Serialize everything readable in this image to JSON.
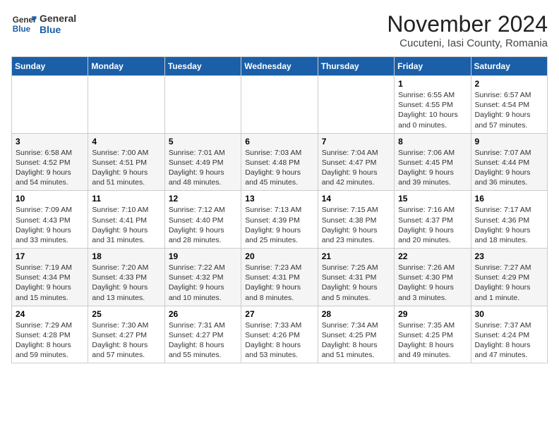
{
  "logo": {
    "line1": "General",
    "line2": "Blue"
  },
  "title": "November 2024",
  "location": "Cucuteni, Iasi County, Romania",
  "headers": [
    "Sunday",
    "Monday",
    "Tuesday",
    "Wednesday",
    "Thursday",
    "Friday",
    "Saturday"
  ],
  "weeks": [
    [
      {
        "day": "",
        "info": ""
      },
      {
        "day": "",
        "info": ""
      },
      {
        "day": "",
        "info": ""
      },
      {
        "day": "",
        "info": ""
      },
      {
        "day": "",
        "info": ""
      },
      {
        "day": "1",
        "info": "Sunrise: 6:55 AM\nSunset: 4:55 PM\nDaylight: 10 hours\nand 0 minutes."
      },
      {
        "day": "2",
        "info": "Sunrise: 6:57 AM\nSunset: 4:54 PM\nDaylight: 9 hours\nand 57 minutes."
      }
    ],
    [
      {
        "day": "3",
        "info": "Sunrise: 6:58 AM\nSunset: 4:52 PM\nDaylight: 9 hours\nand 54 minutes."
      },
      {
        "day": "4",
        "info": "Sunrise: 7:00 AM\nSunset: 4:51 PM\nDaylight: 9 hours\nand 51 minutes."
      },
      {
        "day": "5",
        "info": "Sunrise: 7:01 AM\nSunset: 4:49 PM\nDaylight: 9 hours\nand 48 minutes."
      },
      {
        "day": "6",
        "info": "Sunrise: 7:03 AM\nSunset: 4:48 PM\nDaylight: 9 hours\nand 45 minutes."
      },
      {
        "day": "7",
        "info": "Sunrise: 7:04 AM\nSunset: 4:47 PM\nDaylight: 9 hours\nand 42 minutes."
      },
      {
        "day": "8",
        "info": "Sunrise: 7:06 AM\nSunset: 4:45 PM\nDaylight: 9 hours\nand 39 minutes."
      },
      {
        "day": "9",
        "info": "Sunrise: 7:07 AM\nSunset: 4:44 PM\nDaylight: 9 hours\nand 36 minutes."
      }
    ],
    [
      {
        "day": "10",
        "info": "Sunrise: 7:09 AM\nSunset: 4:43 PM\nDaylight: 9 hours\nand 33 minutes."
      },
      {
        "day": "11",
        "info": "Sunrise: 7:10 AM\nSunset: 4:41 PM\nDaylight: 9 hours\nand 31 minutes."
      },
      {
        "day": "12",
        "info": "Sunrise: 7:12 AM\nSunset: 4:40 PM\nDaylight: 9 hours\nand 28 minutes."
      },
      {
        "day": "13",
        "info": "Sunrise: 7:13 AM\nSunset: 4:39 PM\nDaylight: 9 hours\nand 25 minutes."
      },
      {
        "day": "14",
        "info": "Sunrise: 7:15 AM\nSunset: 4:38 PM\nDaylight: 9 hours\nand 23 minutes."
      },
      {
        "day": "15",
        "info": "Sunrise: 7:16 AM\nSunset: 4:37 PM\nDaylight: 9 hours\nand 20 minutes."
      },
      {
        "day": "16",
        "info": "Sunrise: 7:17 AM\nSunset: 4:36 PM\nDaylight: 9 hours\nand 18 minutes."
      }
    ],
    [
      {
        "day": "17",
        "info": "Sunrise: 7:19 AM\nSunset: 4:34 PM\nDaylight: 9 hours\nand 15 minutes."
      },
      {
        "day": "18",
        "info": "Sunrise: 7:20 AM\nSunset: 4:33 PM\nDaylight: 9 hours\nand 13 minutes."
      },
      {
        "day": "19",
        "info": "Sunrise: 7:22 AM\nSunset: 4:32 PM\nDaylight: 9 hours\nand 10 minutes."
      },
      {
        "day": "20",
        "info": "Sunrise: 7:23 AM\nSunset: 4:31 PM\nDaylight: 9 hours\nand 8 minutes."
      },
      {
        "day": "21",
        "info": "Sunrise: 7:25 AM\nSunset: 4:31 PM\nDaylight: 9 hours\nand 5 minutes."
      },
      {
        "day": "22",
        "info": "Sunrise: 7:26 AM\nSunset: 4:30 PM\nDaylight: 9 hours\nand 3 minutes."
      },
      {
        "day": "23",
        "info": "Sunrise: 7:27 AM\nSunset: 4:29 PM\nDaylight: 9 hours\nand 1 minute."
      }
    ],
    [
      {
        "day": "24",
        "info": "Sunrise: 7:29 AM\nSunset: 4:28 PM\nDaylight: 8 hours\nand 59 minutes."
      },
      {
        "day": "25",
        "info": "Sunrise: 7:30 AM\nSunset: 4:27 PM\nDaylight: 8 hours\nand 57 minutes."
      },
      {
        "day": "26",
        "info": "Sunrise: 7:31 AM\nSunset: 4:27 PM\nDaylight: 8 hours\nand 55 minutes."
      },
      {
        "day": "27",
        "info": "Sunrise: 7:33 AM\nSunset: 4:26 PM\nDaylight: 8 hours\nand 53 minutes."
      },
      {
        "day": "28",
        "info": "Sunrise: 7:34 AM\nSunset: 4:25 PM\nDaylight: 8 hours\nand 51 minutes."
      },
      {
        "day": "29",
        "info": "Sunrise: 7:35 AM\nSunset: 4:25 PM\nDaylight: 8 hours\nand 49 minutes."
      },
      {
        "day": "30",
        "info": "Sunrise: 7:37 AM\nSunset: 4:24 PM\nDaylight: 8 hours\nand 47 minutes."
      }
    ]
  ]
}
